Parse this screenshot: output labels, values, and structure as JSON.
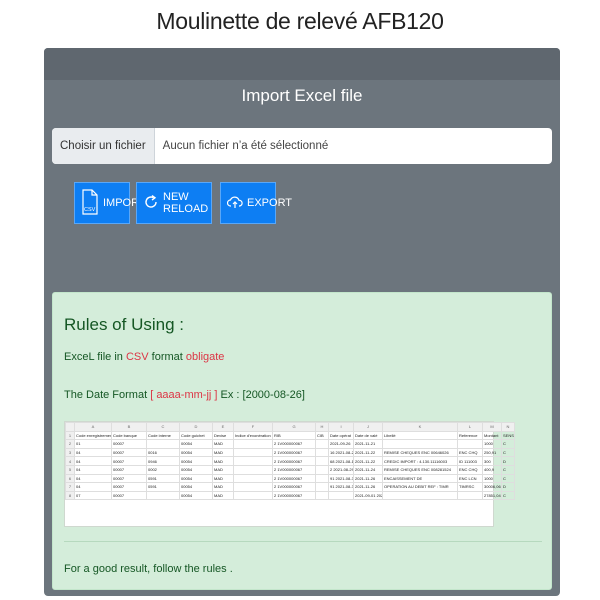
{
  "page": {
    "title": "Moulinette de relevé AFB120"
  },
  "import": {
    "title": "Import Excel file",
    "choose_label": "Choisir un fichier",
    "no_file_label": "Aucun fichier n’a été sélectionné"
  },
  "buttons": {
    "import": "IMPORT",
    "reload": "NEW RELOAD",
    "export": "EXPORT",
    "csv_badge": "CSV"
  },
  "rules": {
    "title": "Rules of Using :",
    "line1_prefix": "ExceL file in ",
    "line1_csv": "CSV",
    "line1_mid": " format ",
    "line1_obligate": "obligate",
    "line2_prefix": "The Date Format ",
    "line2_format": "[ aaaa-mm-jj ]",
    "line2_suffix": " Ex : [2000-08-26]",
    "footer": "For a good result, follow the rules ."
  },
  "sample_table": {
    "columns": [
      "",
      "A",
      "B",
      "C",
      "D",
      "E",
      "F",
      "G",
      "H",
      "I",
      "J",
      "K",
      "L",
      "M",
      "N"
    ],
    "rows": [
      [
        "1",
        "Code enregistrement",
        "Code banque",
        "Code interne",
        "Code guichet",
        "Devise",
        "Indice d'exonération",
        "RIB",
        "CIB",
        "Date opérat",
        "Date de valé",
        "Libellé",
        "Reference",
        "Montant",
        "SENS"
      ],
      [
        "2",
        "01",
        "00007",
        "",
        "00054",
        "MAD",
        "",
        "2 1V000000067",
        "",
        "2021-09-26",
        "2021-11-21",
        "",
        "",
        "1000",
        "C"
      ],
      [
        "3",
        "04",
        "00007",
        "0016",
        "00054",
        "MAD",
        "",
        "2 1V000000067",
        "",
        "16 2021-08-27",
        "2021-11-22",
        "REMISE CHEQUES ENC 00646026",
        "ENC CHQ",
        "250,91",
        "C"
      ],
      [
        "4",
        "04",
        "00007",
        "0946",
        "00054",
        "MAD",
        "",
        "2 1V000000067",
        "",
        "68 2021-08-18",
        "2021-11-22",
        "CREDIC IMPORT : 4.130.11116003",
        "ID 111003",
        "300",
        "D"
      ],
      [
        "5",
        "04",
        "00007",
        "0002",
        "00054",
        "MAD",
        "",
        "2 1V000000067",
        "",
        "2 2021-08-29",
        "2021-11-24",
        "REMISE CHEQUES ENC 008281524",
        "ENC CHQ",
        "400,9",
        "C"
      ],
      [
        "6",
        "04",
        "00007",
        "0591",
        "00054",
        "MAD",
        "",
        "2 1V000000067",
        "",
        "91 2021-08-31",
        "2021-11-26",
        "ENCAISSEMENT DE",
        "ENC LCN",
        "1000",
        "C"
      ],
      [
        "7",
        "04",
        "00007",
        "0591",
        "00054",
        "MAD",
        "",
        "2 1V000000067",
        "",
        "91 2021-08-31",
        "2021-11-26",
        "OPERATION AU DEBIT REF : TIMR",
        "TIMRSC",
        "30006,06",
        "D"
      ],
      [
        "8",
        "07",
        "00007",
        "",
        "00054",
        "MAD",
        "",
        "2 1V000000067",
        "",
        "",
        "2021-09-01 2021-11-27",
        "",
        "",
        "27851,04",
        "C"
      ]
    ]
  },
  "colors": {
    "panel": "#6c757d",
    "button": "#0d7ef3",
    "rules_bg": "#d4edda",
    "rules_text": "#155724",
    "accent_red": "#dc3545"
  },
  "icons": {
    "import": "csv-file-icon",
    "reload": "refresh-icon",
    "export": "cloud-upload-icon"
  }
}
